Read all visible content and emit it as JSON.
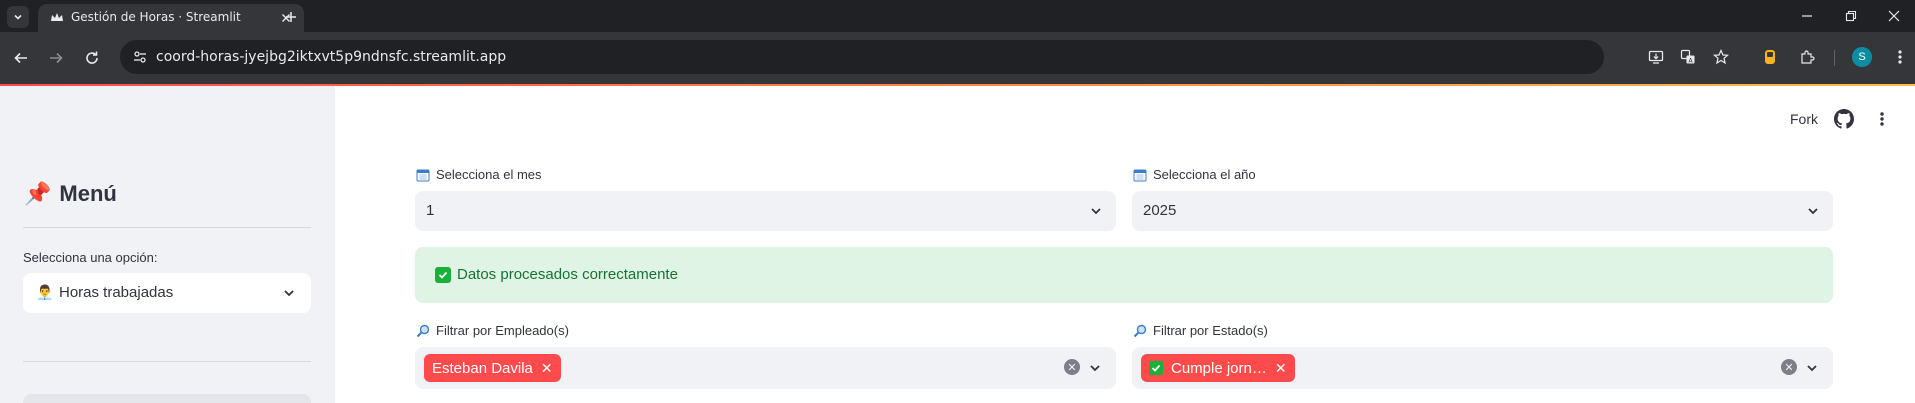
{
  "browser": {
    "tab_title": "Gestión de Horas · Streamlit",
    "url": "coord-horas-jyejbg2iktxvt5p9ndnsfc.streamlit.app",
    "profile_initial": "S"
  },
  "sidebar": {
    "title_emoji": "📌",
    "title": "Menú",
    "select_label": "Selecciona una opción:",
    "select_emoji": "👨‍💼",
    "select_value": "Horas trabajadas"
  },
  "header": {
    "fork_label": "Fork"
  },
  "filters": {
    "month_label": "Selecciona el mes",
    "month_value": "1",
    "year_label": "Selecciona el año",
    "year_value": "2025",
    "employee_label": "Filtrar por Empleado(s)",
    "employee_chips": [
      "Esteban Davila"
    ],
    "status_label": "Filtrar por Estado(s)",
    "status_chips": [
      "Cumple jorn…"
    ]
  },
  "success": {
    "message": "Datos procesados correctamente"
  },
  "colors": {
    "primary": "#ff4b4b",
    "success_bg": "#dff4e5",
    "success_text": "#177233",
    "sidebar_bg": "#f0f2f6"
  }
}
